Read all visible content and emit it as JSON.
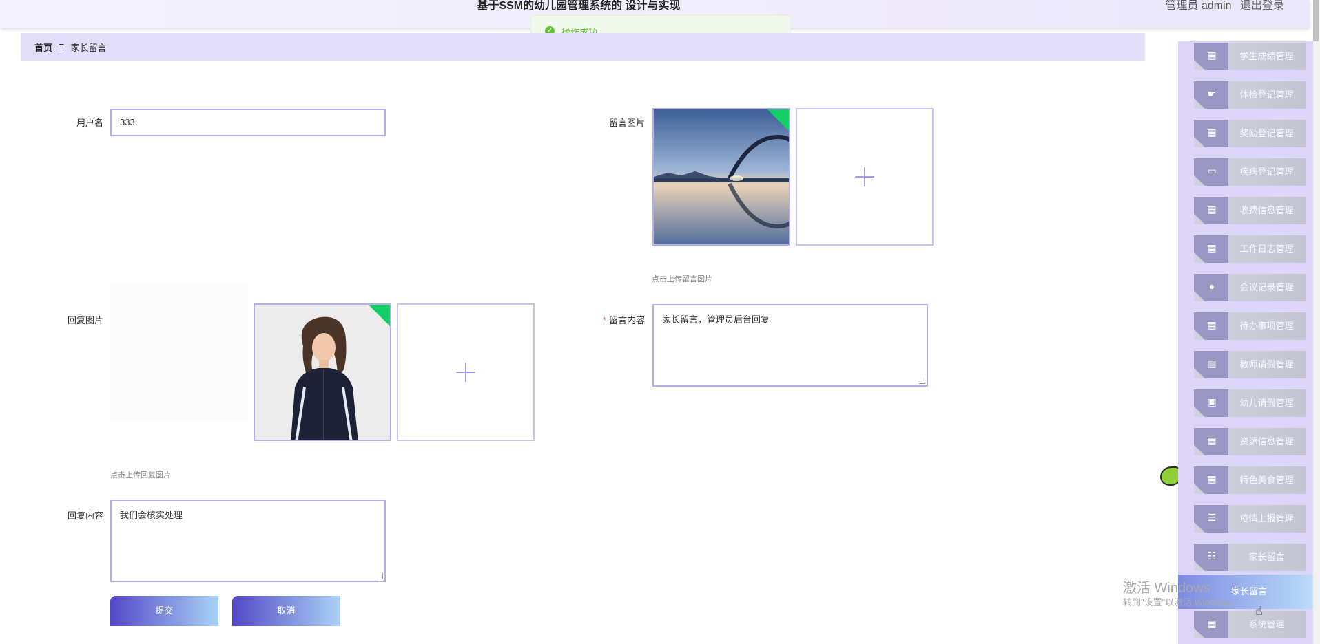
{
  "header": {
    "app_title": "基于SSM的幼儿园管理系统的 设计与实现",
    "user_role": "管理员 admin",
    "logout": "退出登录"
  },
  "toast": {
    "message": "操作成功",
    "icon": "success-check-icon"
  },
  "breadcrumb": {
    "home": "首页",
    "separator": "Ξ",
    "current": "家长留言"
  },
  "form": {
    "username": {
      "label": "用户名",
      "value": "333"
    },
    "message_image": {
      "label": "留言图片",
      "hint": "点击上传留言图片"
    },
    "reply_image": {
      "label": "回复图片",
      "hint": "点击上传回复图片"
    },
    "message_content": {
      "label": "留言内容",
      "required_mark": "*",
      "value": "家长留言，管理员后台回复"
    },
    "reply_content": {
      "label": "回复内容",
      "value": "我们会核实处理"
    },
    "buttons": {
      "submit": "提交",
      "cancel": "取消"
    }
  },
  "sidebar": {
    "items": [
      {
        "label": "学生成绩管理",
        "icon": "grid-icon"
      },
      {
        "label": "体检登记管理",
        "icon": "thumb-icon"
      },
      {
        "label": "奖励登记管理",
        "icon": "grid-icon"
      },
      {
        "label": "疾病登记管理",
        "icon": "monitor-icon"
      },
      {
        "label": "收费信息管理",
        "icon": "grid-icon"
      },
      {
        "label": "工作日志管理",
        "icon": "grid-icon"
      },
      {
        "label": "会议记录管理",
        "icon": "user-icon"
      },
      {
        "label": "待办事项管理",
        "icon": "grid-icon"
      },
      {
        "label": "教师请假管理",
        "icon": "bar-chart-icon"
      },
      {
        "label": "幼儿请假管理",
        "icon": "briefcase-icon"
      },
      {
        "label": "资源信息管理",
        "icon": "grid-icon"
      },
      {
        "label": "特色美食管理",
        "icon": "grid-icon"
      },
      {
        "label": "疫情上报管理",
        "icon": "list-icon"
      },
      {
        "label": "家长留言",
        "icon": "sliders-icon"
      }
    ],
    "active_item": "家长留言",
    "last_item": {
      "label": "系统管理",
      "icon": "grid-icon"
    }
  },
  "watermark": {
    "line1": "激活 Windows",
    "line2": "转到\"设置\"以激活 Windows。"
  }
}
